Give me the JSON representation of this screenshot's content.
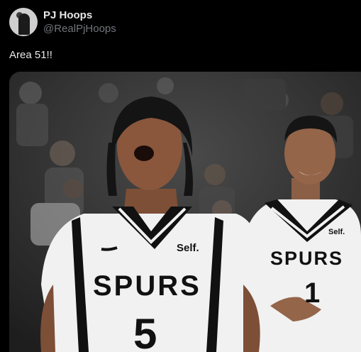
{
  "author": {
    "display_name": "PJ Hoops",
    "handle": "@RealPjHoops",
    "avatar_icon": "user-avatar-icon"
  },
  "tweet": {
    "text": "Area 51!!"
  },
  "media": {
    "jersey_wordmark": "SPURS",
    "sponsor": "Self.",
    "left_player_number": "5",
    "right_player_number": "1",
    "colors": {
      "jersey": "#f1f1f1",
      "trim": "#111111",
      "crowd": "#3a3a3a"
    }
  }
}
